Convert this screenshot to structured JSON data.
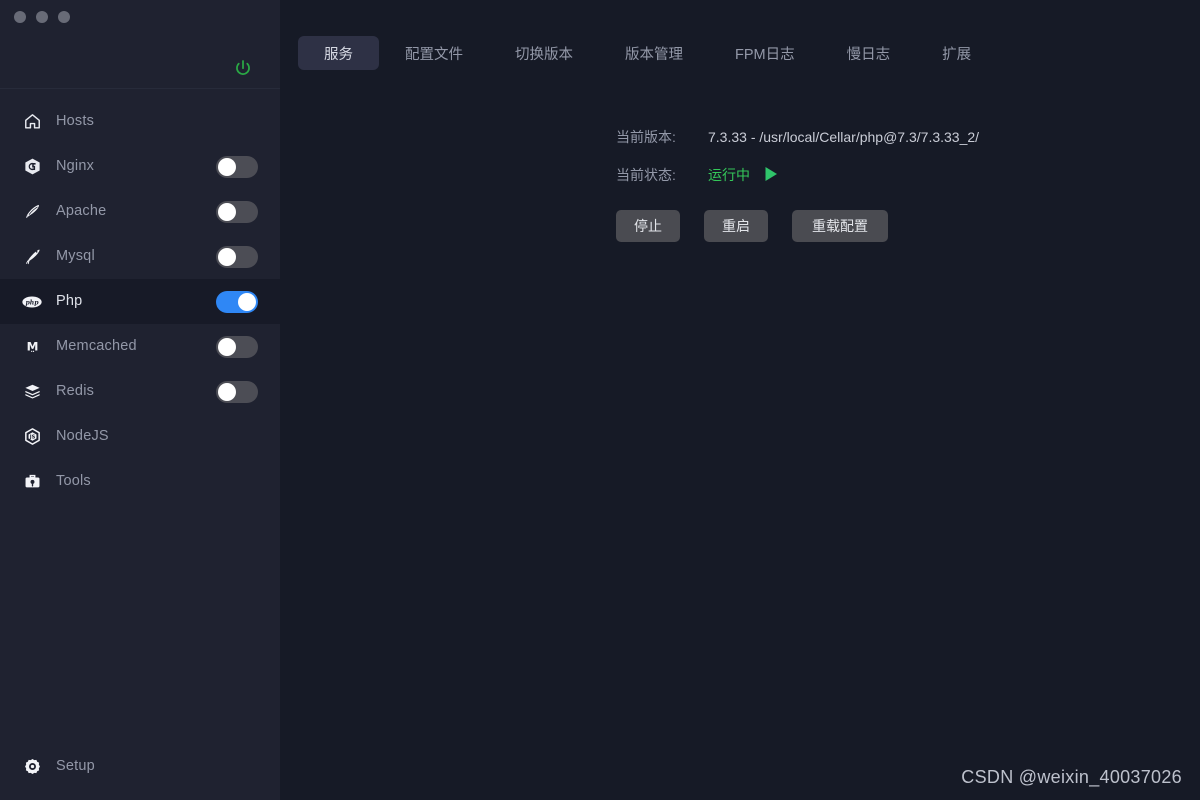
{
  "window": {
    "traffic_lights": [
      "close",
      "minimize",
      "zoom"
    ],
    "power_icon": "power-icon",
    "power_color": "#2aa745"
  },
  "sidebar": {
    "items": [
      {
        "label": "Hosts",
        "icon": "home-icon",
        "has_toggle": false,
        "toggle_on": false,
        "active": false
      },
      {
        "label": "Nginx",
        "icon": "nginx-icon",
        "has_toggle": true,
        "toggle_on": false,
        "active": false
      },
      {
        "label": "Apache",
        "icon": "apache-icon",
        "has_toggle": true,
        "toggle_on": false,
        "active": false
      },
      {
        "label": "Mysql",
        "icon": "mysql-icon",
        "has_toggle": true,
        "toggle_on": false,
        "active": false
      },
      {
        "label": "Php",
        "icon": "php-icon",
        "has_toggle": true,
        "toggle_on": true,
        "active": true
      },
      {
        "label": "Memcached",
        "icon": "memcached-icon",
        "has_toggle": true,
        "toggle_on": false,
        "active": false
      },
      {
        "label": "Redis",
        "icon": "redis-icon",
        "has_toggle": true,
        "toggle_on": false,
        "active": false
      },
      {
        "label": "NodeJS",
        "icon": "nodejs-icon",
        "has_toggle": false,
        "toggle_on": false,
        "active": false
      },
      {
        "label": "Tools",
        "icon": "tools-icon",
        "has_toggle": false,
        "toggle_on": false,
        "active": false
      }
    ],
    "footer": {
      "label": "Setup",
      "icon": "gear-icon"
    }
  },
  "main": {
    "tabs": [
      {
        "label": "服务",
        "active": true
      },
      {
        "label": "配置文件",
        "active": false
      },
      {
        "label": "切换版本",
        "active": false
      },
      {
        "label": "版本管理",
        "active": false
      },
      {
        "label": "FPM日志",
        "active": false
      },
      {
        "label": "慢日志",
        "active": false
      },
      {
        "label": "扩展",
        "active": false
      }
    ],
    "info": {
      "version_label": "当前版本:",
      "version_value": "7.3.33 - /usr/local/Cellar/php@7.3/7.3.33_2/",
      "status_label": "当前状态:",
      "status_value": "运行中",
      "status_icon": "play-icon",
      "status_color": "#34c759"
    },
    "buttons": [
      {
        "label": "停止"
      },
      {
        "label": "重启"
      },
      {
        "label": "重载配置"
      }
    ]
  },
  "watermark": {
    "text": "CSDN @weixin_40037026"
  },
  "theme": {
    "sidebar_bg": "#1f2230",
    "main_bg": "#161a26",
    "active_row_bg": "#171a27",
    "active_tab_bg": "#2e3145",
    "toggle_on": "#2f87f5",
    "toggle_off": "#4c4d55",
    "button_bg": "#4a4b51",
    "accent_green": "#34c759"
  }
}
